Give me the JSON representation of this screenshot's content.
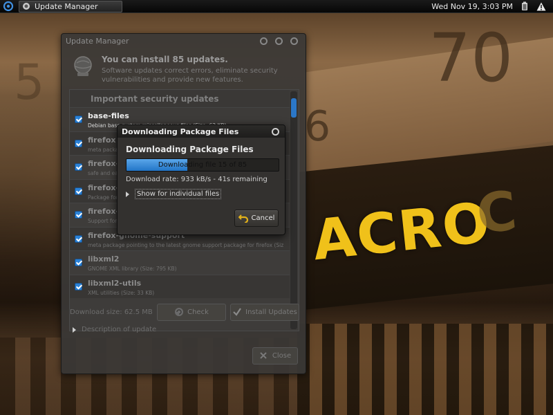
{
  "panel": {
    "task_label": "Update Manager",
    "clock": "Wed Nov 19,  3:03 PM"
  },
  "update_manager": {
    "title": "Update Manager",
    "heading": "You can install 85 updates.",
    "subtext": "Software updates correct errors, eliminate security vulnerabilities and provide new features.",
    "section": "Important security updates",
    "packages": [
      {
        "name": "base-files",
        "desc": "Debian base system miscellaneous files (Size: 63 KB)",
        "checked": true
      },
      {
        "name": "firefox",
        "desc": "meta package pointing to the latest gnome supported package",
        "checked": true
      },
      {
        "name": "firefox-",
        "desc": "safe and easy web browser from Mozilla",
        "checked": true
      },
      {
        "name": "firefox-",
        "desc": "Package for firefox",
        "checked": true
      },
      {
        "name": "firefox-",
        "desc": "Support for firefox",
        "checked": true
      },
      {
        "name": "firefox-gnome-support",
        "desc": "meta package pointing to the latest gnome support package for firefox (Siz",
        "checked": true
      },
      {
        "name": "libxml2",
        "desc": "GNOME XML library (Size: 795 KB)",
        "checked": true
      },
      {
        "name": "libxml2-utils",
        "desc": "XML utilities (Size: 33 KB)",
        "checked": true
      }
    ],
    "download_size": "Download size: 62.5 MB",
    "check_label": "Check",
    "install_label": "Install Updates",
    "description_label": "Description of update",
    "close_label": "Close"
  },
  "download_dialog": {
    "title": "Downloading Package Files",
    "heading": "Downloading Package Files",
    "progress_text": "Downloading file 15 of 85",
    "progress_fraction": 0.4,
    "rate_text": "Download rate: 933 kB/s - 41s remaining",
    "expander_label": "Show for individual files",
    "cancel_label": "Cancel"
  },
  "colors": {
    "accent": "#2b82d8",
    "wallpaper_highlight": "#f0c11a"
  },
  "wallpaper": {
    "number_1": "70",
    "acro_text": "ACRO",
    "acro_tail": "C",
    "side_number": "6",
    "bottom_number": "5"
  },
  "icons": {
    "menu": "debian-swirl-icon",
    "task": "update-icon",
    "tray_1": "battery-icon",
    "tray_2": "warning-icon",
    "header": "globe-icon",
    "check": "refresh-icon",
    "install": "checkmark-icon",
    "cancel": "undo-arrow-icon"
  }
}
